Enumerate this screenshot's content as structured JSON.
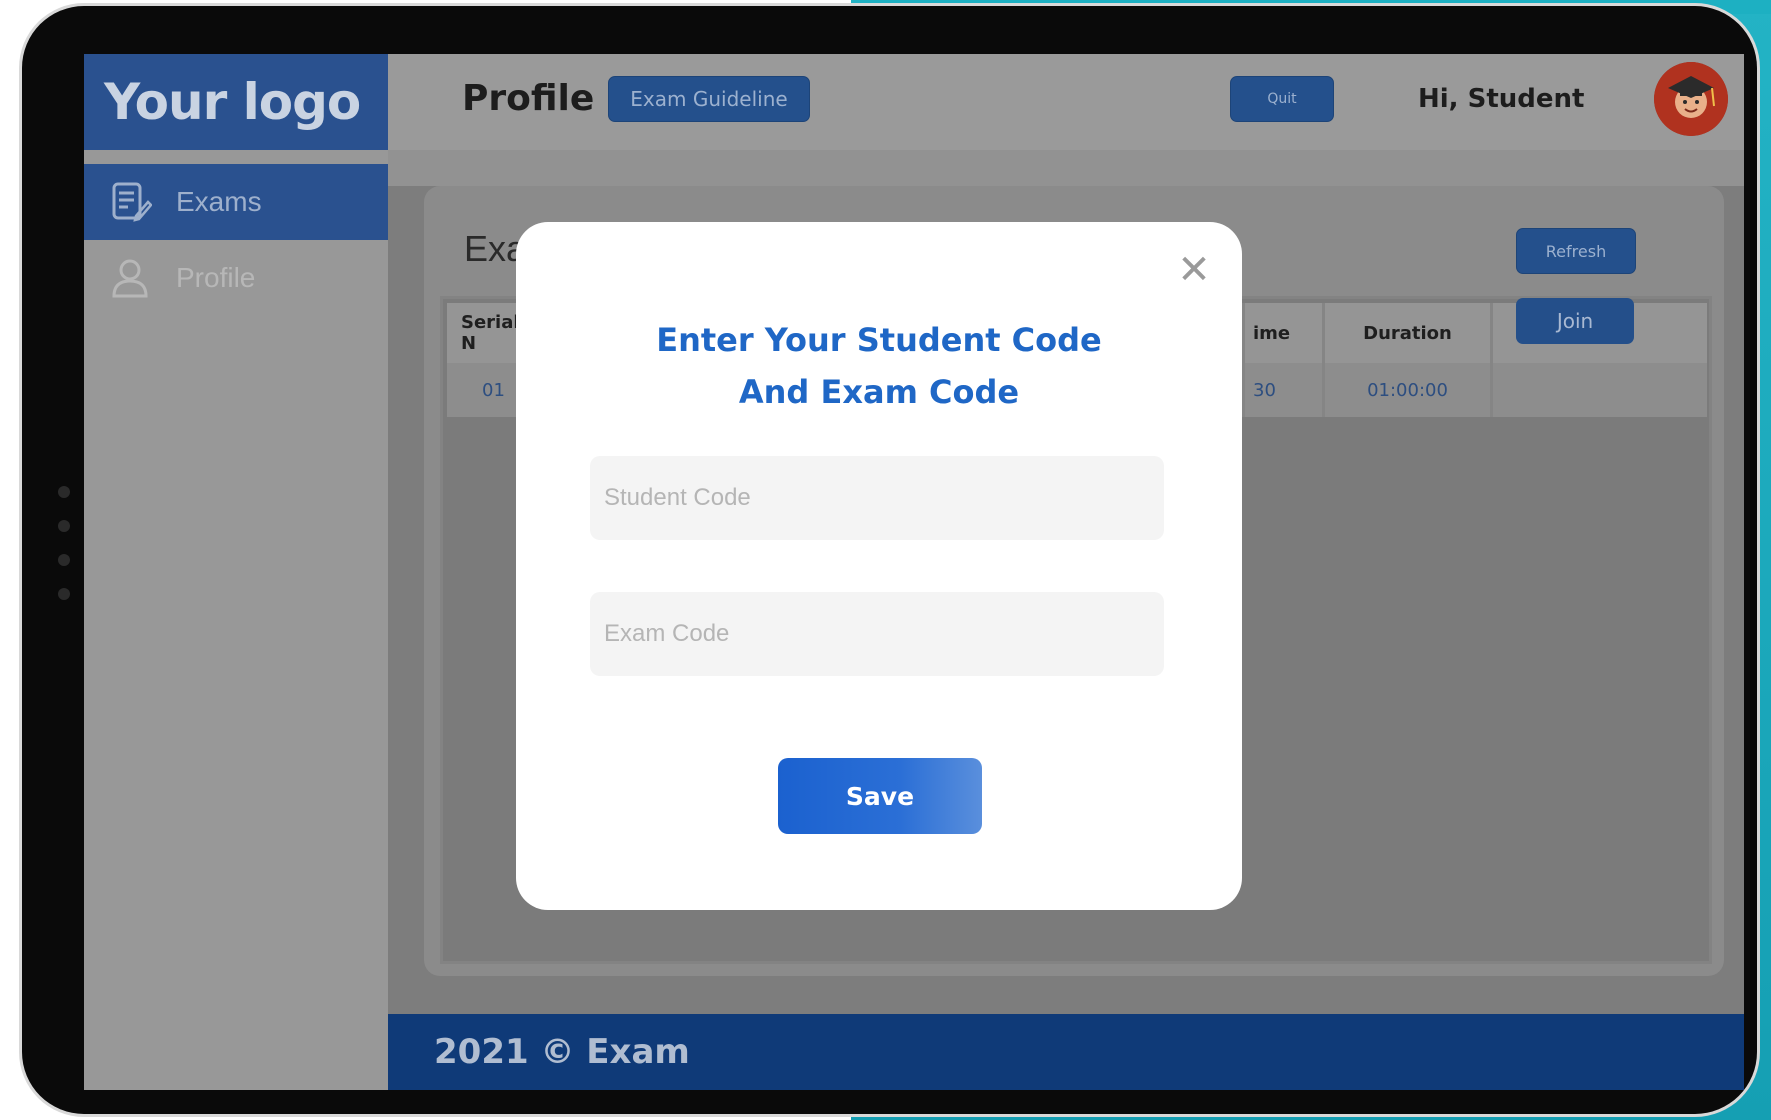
{
  "logo": {
    "text": "Your logo"
  },
  "sidebar": {
    "items": [
      {
        "label": "Exams",
        "icon": "exam-document-icon",
        "active": true
      },
      {
        "label": "Profile",
        "icon": "user-icon",
        "active": false
      }
    ]
  },
  "header": {
    "title": "Profile",
    "guideline_label": "Exam Guideline",
    "quit_label": "Quit",
    "greeting": "Hi, Student",
    "avatar_icon": "student-avatar-icon"
  },
  "content": {
    "title": "Exam",
    "refresh_label": "Refresh",
    "table": {
      "columns": [
        "Serial N",
        "ime",
        "Duration",
        ""
      ],
      "rows": [
        {
          "serial": "01",
          "time": "30",
          "duration": "01:00:00",
          "action": "Join"
        }
      ]
    }
  },
  "footer": {
    "text": "2021 © Exam"
  },
  "modal": {
    "title_line1": "Enter Your Student Code",
    "title_line2": "And Exam Code",
    "student_code_placeholder": "Student Code",
    "exam_code_placeholder": "Exam Code",
    "save_label": "Save",
    "close_icon": "close-icon"
  },
  "colors": {
    "brand_blue": "#2a518f",
    "accent_blue": "#1f67c6",
    "teal": "#1db0c2"
  }
}
